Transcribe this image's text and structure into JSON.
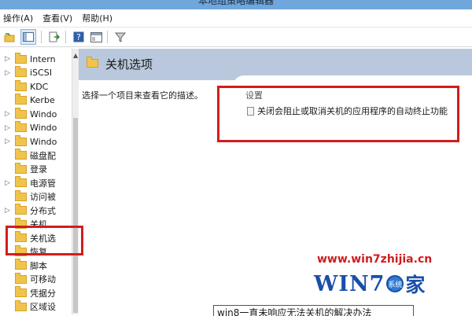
{
  "window": {
    "title": "本地组策略编辑器"
  },
  "menu": [
    {
      "label": "操作(A)"
    },
    {
      "label": "查看(V)"
    },
    {
      "label": "帮助(H)"
    }
  ],
  "toolbar": [
    {
      "icon": "back-folder-icon"
    },
    {
      "icon": "show-tree-icon"
    },
    {
      "icon": "export-icon"
    },
    {
      "icon": "help-icon"
    },
    {
      "icon": "console-icon"
    },
    {
      "icon": "filter-icon"
    }
  ],
  "tree": {
    "items": [
      {
        "label": "Intern",
        "expandable": true
      },
      {
        "label": "iSCSI",
        "expandable": true
      },
      {
        "label": "KDC",
        "expandable": false
      },
      {
        "label": "Kerbe",
        "expandable": false
      },
      {
        "label": "Windo",
        "expandable": true
      },
      {
        "label": "Windo",
        "expandable": true
      },
      {
        "label": "Windo",
        "expandable": true
      },
      {
        "label": "磁盘配",
        "expandable": false
      },
      {
        "label": "登录",
        "expandable": false
      },
      {
        "label": "电源管",
        "expandable": true
      },
      {
        "label": "访问被",
        "expandable": false
      },
      {
        "label": "分布式",
        "expandable": true
      },
      {
        "label": "关机",
        "expandable": false
      },
      {
        "label": "关机选",
        "expandable": false,
        "selected": true
      },
      {
        "label": "恢复",
        "expandable": false
      },
      {
        "label": "脚本",
        "expandable": false
      },
      {
        "label": "可移动",
        "expandable": false
      },
      {
        "label": "凭据分",
        "expandable": false
      },
      {
        "label": "区域设",
        "expandable": false
      }
    ]
  },
  "details": {
    "header": "关机选项",
    "description": "选择一个项目来查看它的描述。",
    "settings_header": "设置",
    "settings": [
      {
        "label": "关闭会阻止或取消关机的应用程序的自动终止功能"
      }
    ]
  },
  "watermark": {
    "url": "www.win7zhijia.cn",
    "logo_text": "WIN7",
    "logo_suffix": "家",
    "ball_text": "系统"
  },
  "caption": "win8一直未响应无法关机的解决办法",
  "colors": {
    "highlight_red": "#d21d1d",
    "header_blue": "#b9c8dc",
    "titlebar_blue": "#6fa7dc",
    "watermark_blue": "#1a4fa8"
  }
}
